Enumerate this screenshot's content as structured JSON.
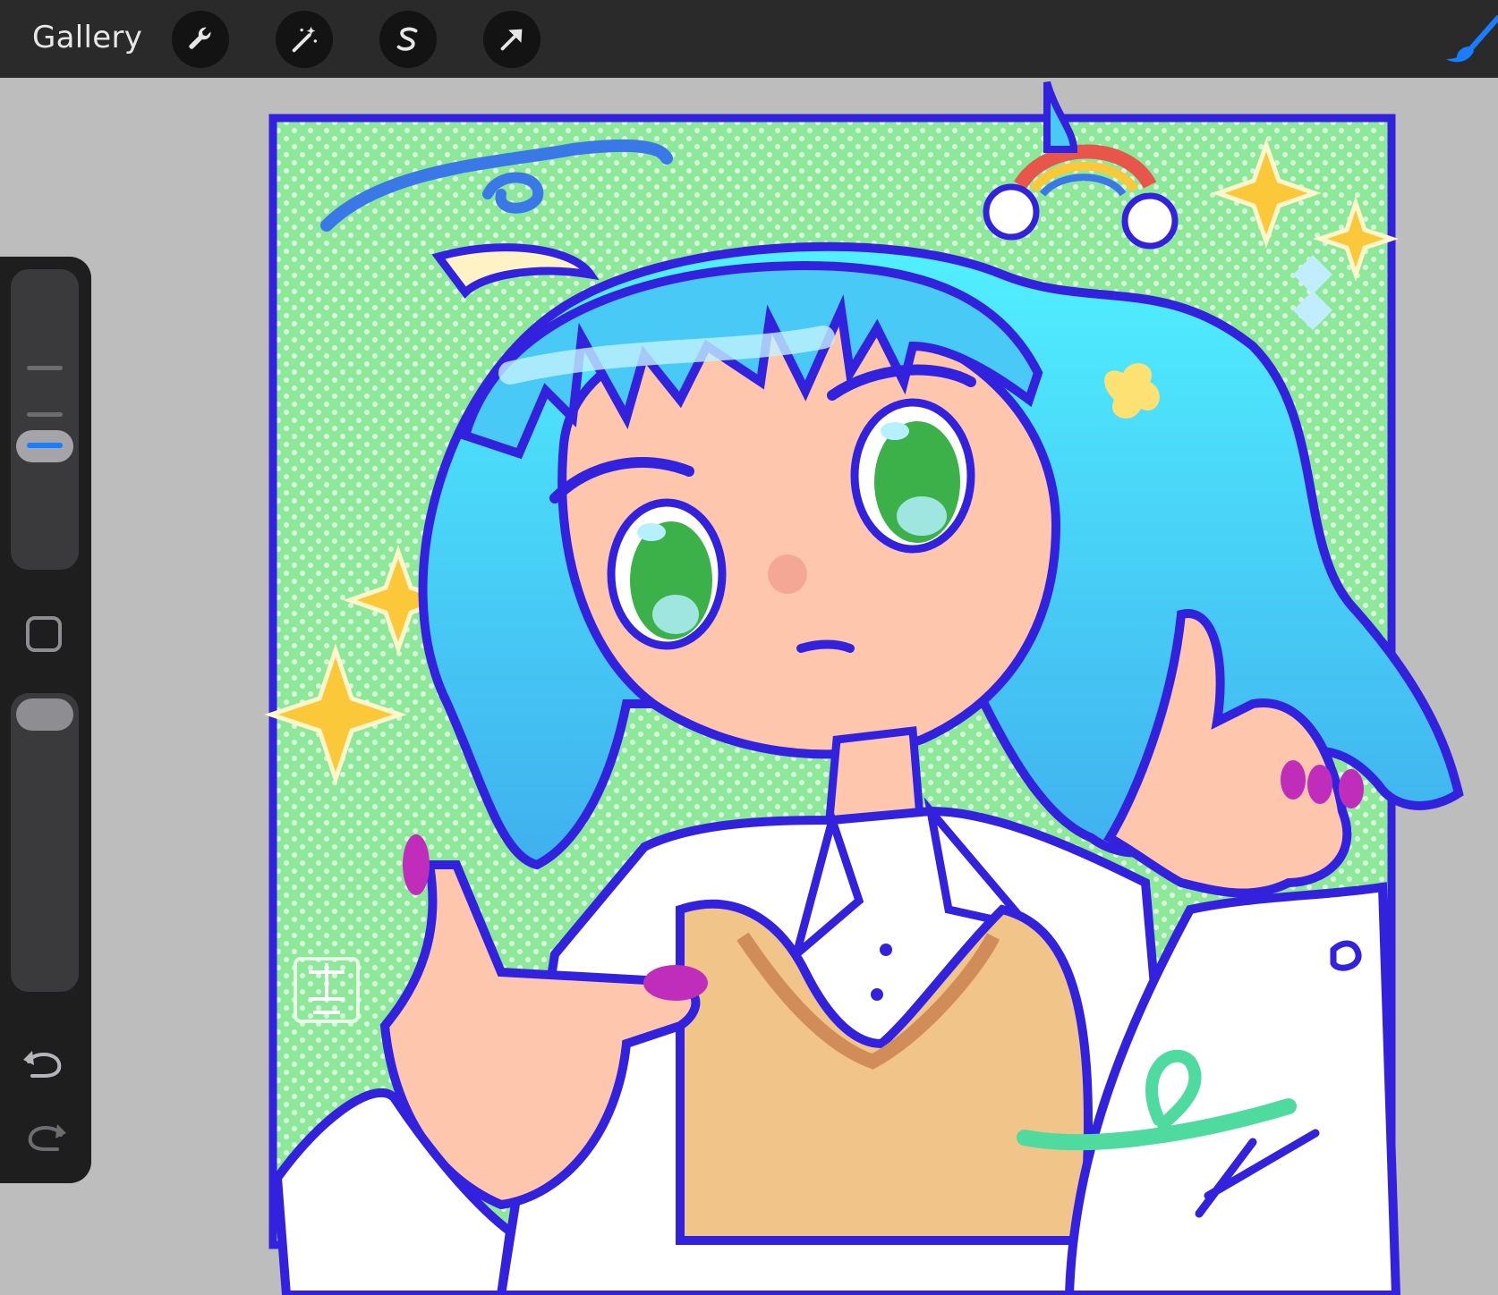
{
  "topbar": {
    "gallery_label": "Gallery",
    "tools": [
      {
        "name": "actions",
        "icon": "wrench-icon"
      },
      {
        "name": "adjustments",
        "icon": "magic-wand-icon"
      },
      {
        "name": "selection",
        "icon": "selection-s-icon"
      },
      {
        "name": "transform",
        "icon": "arrow-cursor-icon"
      }
    ],
    "active_tool": {
      "name": "brush",
      "icon": "paintbrush-icon",
      "color": "#1a7cff"
    }
  },
  "sidebar": {
    "brush_size_level": 0.62,
    "brush_opacity_level": 0.0,
    "modify_button_icon": "square-modify-icon",
    "undo_icon": "undo-icon",
    "redo_icon": "redo-icon"
  },
  "canvas": {
    "background_color": "#bdbdbd",
    "artwork_frame_color": "#3322dd",
    "artwork_bg_color": "#8de89a",
    "signature": "artist-signature-glyph"
  },
  "colors": {
    "hair": "#49c9f5",
    "skin": "#fec7ad",
    "eyes": "#3cb14a",
    "vest": "#f1c48a",
    "outline": "#3322dd",
    "star": "#fbc83a"
  }
}
